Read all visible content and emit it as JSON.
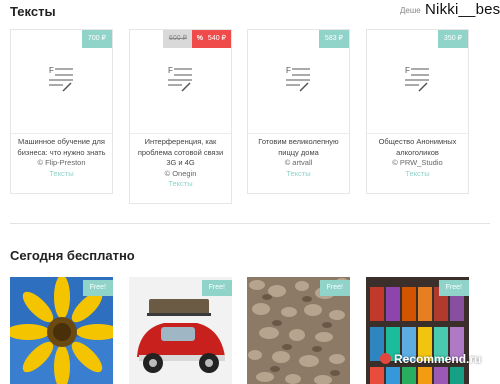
{
  "header": {
    "section_texts": "Тексты",
    "sort_label": "Деше",
    "watermark_user": "Nikki__best"
  },
  "cards": [
    {
      "price": "700 ₽",
      "title": "Машинное обучение для бизнеса: что нужно знать",
      "author": "© Flip-Preston",
      "category": "Тексты"
    },
    {
      "price_old": "600 ₽",
      "sale_icon": "%",
      "price": "540 ₽",
      "title": "Интерференция, как проблема сотовой связи 3G и 4G",
      "author": "© Onegin",
      "category": "Тексты"
    },
    {
      "price": "583 ₽",
      "title": "Готовим великолепную пиццу дома",
      "author": "© artvall",
      "category": "Тексты"
    },
    {
      "price": "350 ₽",
      "title": "Общество Анонимных алкоголиков",
      "author": "© PRW_Studio",
      "category": "Тексты"
    }
  ],
  "free_section": {
    "title": "Сегодня бесплатно",
    "items": [
      {
        "badge": "Free!",
        "image": "sunflower"
      },
      {
        "badge": "Free!",
        "image": "red-vintage-car"
      },
      {
        "badge": "Free!",
        "image": "pebbles"
      },
      {
        "badge": "Free!",
        "image": "thread-spools"
      }
    ]
  },
  "watermark": {
    "text": "Recommend.ru"
  },
  "colors": {
    "accent": "#8fd3c9",
    "sale": "#ef4b4b"
  }
}
